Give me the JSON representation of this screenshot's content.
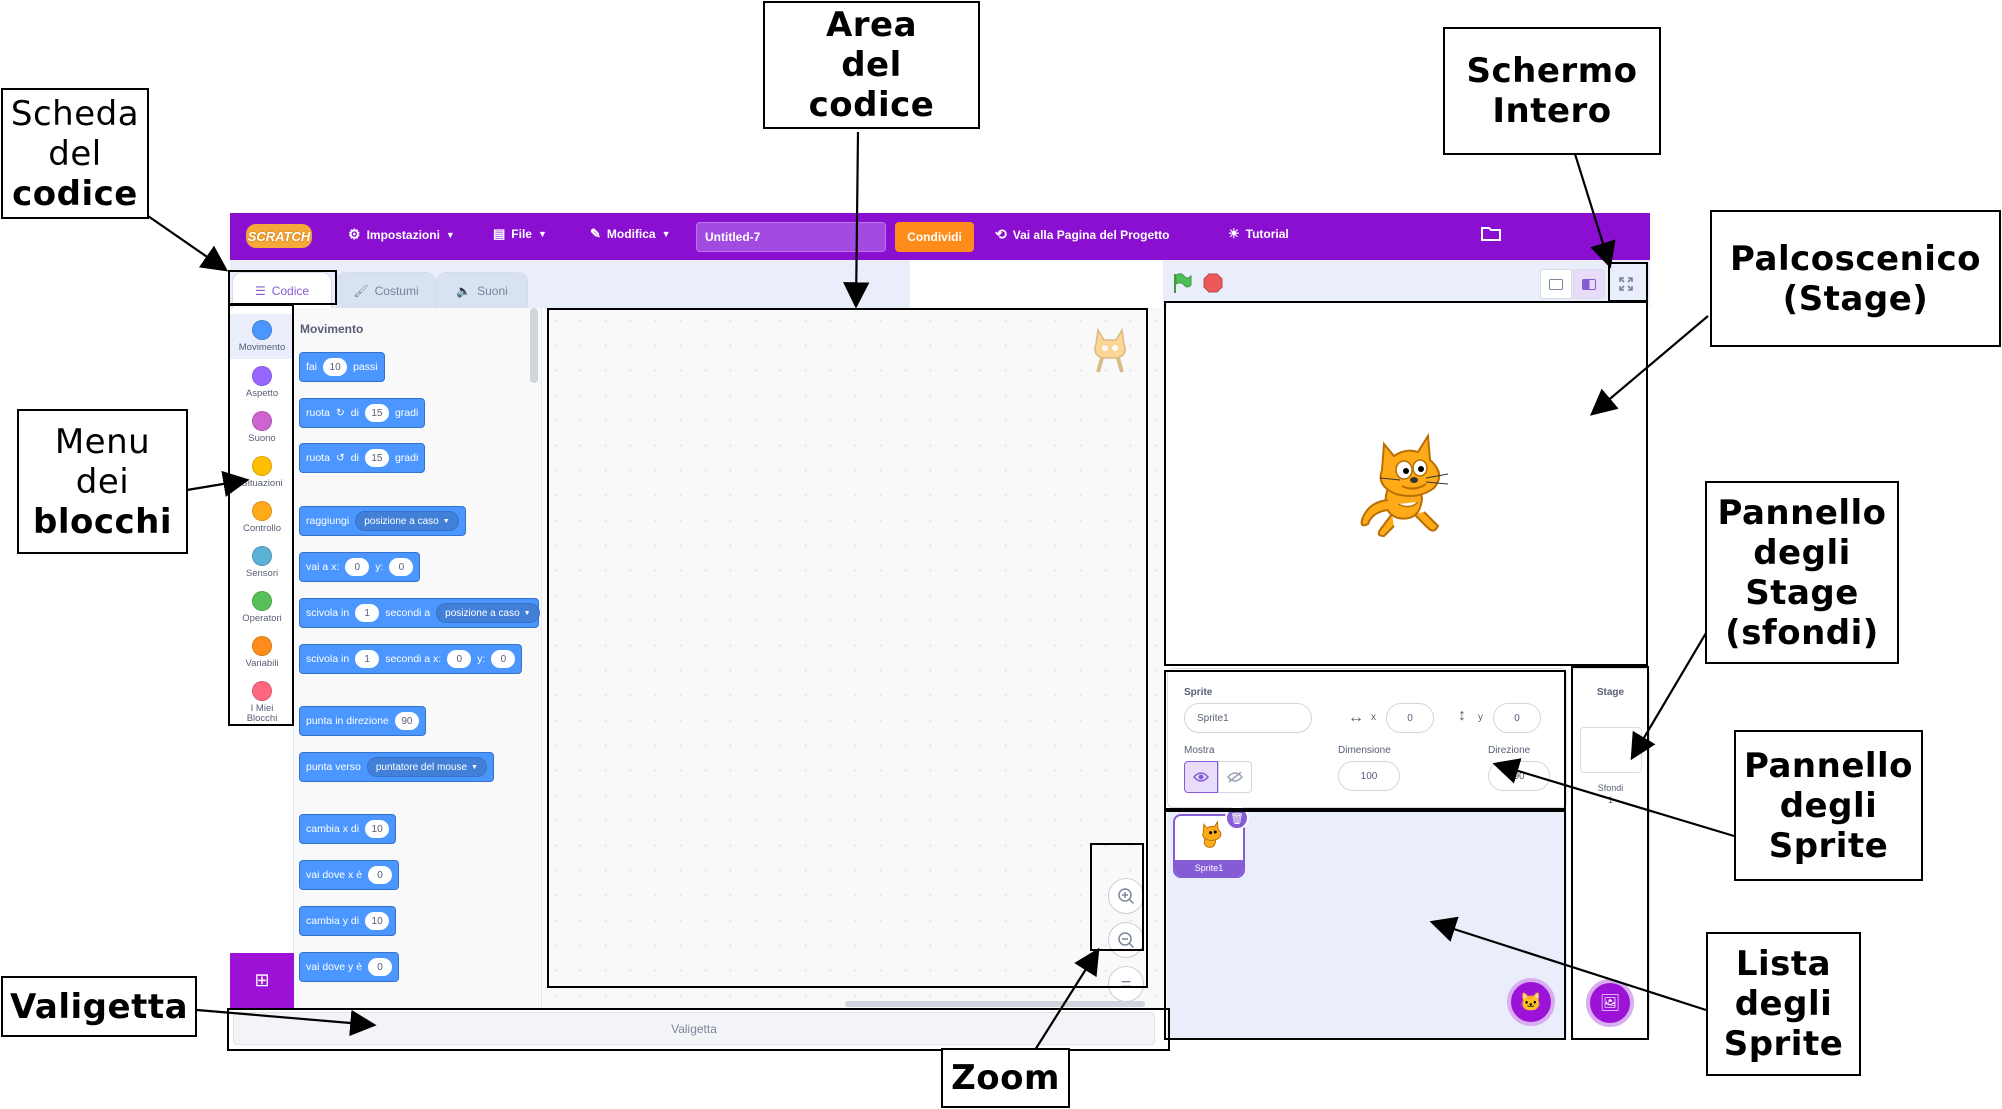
{
  "menubar": {
    "logo": "SCRATCH",
    "settings": "Impostazioni",
    "file": "File",
    "edit": "Modifica",
    "project_title": "Untitled-7",
    "share": "Condividi",
    "project_page": "Vai alla Pagina del Progetto",
    "tutorials": "Tutorial"
  },
  "tabs": {
    "code": "Codice",
    "costumes": "Costumi",
    "sounds": "Suoni"
  },
  "categories": [
    {
      "label": "Movimento",
      "color": "#4c97ff"
    },
    {
      "label": "Aspetto",
      "color": "#9966ff"
    },
    {
      "label": "Suono",
      "color": "#cf63cf"
    },
    {
      "label": "Situazioni",
      "color": "#ffbf00"
    },
    {
      "label": "Controllo",
      "color": "#ffab19"
    },
    {
      "label": "Sensori",
      "color": "#5cb1d6"
    },
    {
      "label": "Operatori",
      "color": "#59c059"
    },
    {
      "label": "Variabili",
      "color": "#ff8c1a"
    },
    {
      "label": "I Miei Blocchi",
      "color": "#ff6680"
    }
  ],
  "palette": {
    "title": "Movimento",
    "blocks": {
      "move": [
        "fai",
        "10",
        "passi"
      ],
      "turn_right": [
        "ruota",
        "di",
        "15",
        "gradi"
      ],
      "turn_left": [
        "ruota",
        "di",
        "15",
        "gradi"
      ],
      "goto": [
        "raggiungi",
        "posizione a caso"
      ],
      "goto_xy": [
        "vai a x:",
        "0",
        "y:",
        "0"
      ],
      "glide": [
        "scivola in",
        "1",
        "secondi a",
        "posizione a caso"
      ],
      "glide_xy": [
        "scivola in",
        "1",
        "secondi a x:",
        "0",
        "y:",
        "0"
      ],
      "point_dir": [
        "punta in direzione",
        "90"
      ],
      "point_to": [
        "punta verso",
        "puntatore del mouse"
      ],
      "change_x": [
        "cambia x di",
        "10"
      ],
      "set_x": [
        "vai dove x è",
        "0"
      ],
      "change_y": [
        "cambia y di",
        "10"
      ],
      "set_y": [
        "vai dove y è",
        "0"
      ]
    }
  },
  "backpack": "Valigetta",
  "zoom": {
    "reset": "="
  },
  "sprite_info": {
    "sprite_label": "Sprite",
    "sprite_name": "Sprite1",
    "x_label": "x",
    "x_value": "0",
    "y_label": "y",
    "y_value": "0",
    "show_label": "Mostra",
    "size_label": "Dimensione",
    "size_value": "100",
    "direction_label": "Direzione",
    "direction_value": "90"
  },
  "sprite_list": [
    {
      "name": "Sprite1"
    }
  ],
  "stage_panel": {
    "title": "Stage",
    "backdrops_label": "Sfondi",
    "backdrops_count": "1"
  },
  "annotations": {
    "code_tab": [
      "Scheda",
      "del",
      "codice"
    ],
    "code_area": [
      "Area",
      "del",
      "codice"
    ],
    "fullscreen": [
      "Schermo",
      "Intero"
    ],
    "stage": [
      "Palcoscenico",
      "(Stage)"
    ],
    "block_menu": [
      "Menu",
      "dei",
      "blocchi"
    ],
    "stage_pane": [
      "Pannello",
      "degli",
      "Stage",
      "(sfondi)"
    ],
    "sprite_pane": [
      "Pannello",
      "degli",
      "Sprite"
    ],
    "backpack": [
      "Valigetta"
    ],
    "zoom": [
      "Zoom"
    ],
    "sprite_list": [
      "Lista",
      "degli",
      "Sprite"
    ]
  },
  "colors": {
    "menu": "#8a0fd1",
    "accent": "#855cd6",
    "motion": "#4c97ff",
    "share": "#ff8c1a"
  }
}
